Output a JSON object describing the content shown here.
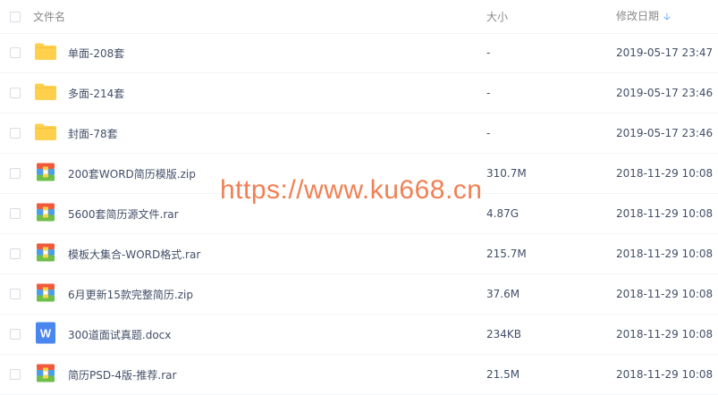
{
  "header": {
    "name_label": "文件名",
    "size_label": "大小",
    "date_label": "修改日期",
    "sort_icon": "arrow-down-icon"
  },
  "files": [
    {
      "name": "单面-208套",
      "size": "-",
      "date": "2019-05-17 23:47",
      "type": "folder"
    },
    {
      "name": "多面-214套",
      "size": "-",
      "date": "2019-05-17 23:46",
      "type": "folder"
    },
    {
      "name": "封面-78套",
      "size": "-",
      "date": "2019-05-17 23:46",
      "type": "folder"
    },
    {
      "name": "200套WORD简历模版.zip",
      "size": "310.7M",
      "date": "2018-11-29 10:08",
      "type": "archive"
    },
    {
      "name": "5600套简历源文件.rar",
      "size": "4.87G",
      "date": "2018-11-29 10:08",
      "type": "archive"
    },
    {
      "name": "模板大集合-WORD格式.rar",
      "size": "215.7M",
      "date": "2018-11-29 10:08",
      "type": "archive"
    },
    {
      "name": "6月更新15款完整简历.zip",
      "size": "37.6M",
      "date": "2018-11-29 10:08",
      "type": "archive"
    },
    {
      "name": "300道面试真题.docx",
      "size": "234KB",
      "date": "2018-11-29 10:08",
      "type": "word"
    },
    {
      "name": "简历PSD-4版-推荐.rar",
      "size": "21.5M",
      "date": "2018-11-29 10:08",
      "type": "archive"
    }
  ],
  "watermark": "https://www.ku668.cn",
  "colors": {
    "folder": "#ffd04d",
    "word": "#4a86f0",
    "sort_arrow": "#3b8cff",
    "watermark": "#f07a4a"
  }
}
